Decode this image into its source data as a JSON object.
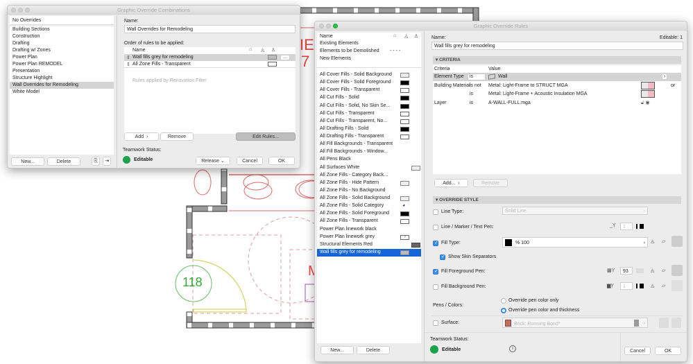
{
  "combinations": {
    "title": "Graphic Override Combinations",
    "no_overrides": "No Overrides",
    "items": [
      "Building Sections",
      "Construction",
      "Drafting",
      "Drafting w/ Zones",
      "Power Plan",
      "Power Plan REMODEL",
      "Presentation",
      "Structure Highlight",
      "Wall Overrides for Remodeling",
      "White Model"
    ],
    "selected": "Wall Overrides for Remodeling",
    "new_label": "New...",
    "delete_label": "Delete",
    "name_label": "Name:",
    "name_value": "Wall Overrides for Remodeling",
    "order_label": "Order of rules to be applied:",
    "col_name": "Name",
    "rules": [
      "Wall fills grey for remodeling",
      "All Zone Fills - Transparent"
    ],
    "more_label": "...",
    "renovation_note": "Rules applied by Renovation Filter",
    "add_label": "Add",
    "remove_label": "Remove",
    "edit_rules_label": "Edit Rules...",
    "teamwork_label": "Teamwork Status:",
    "status": "Editable",
    "release_label": "Release",
    "cancel_label": "Cancel",
    "ok_label": "OK"
  },
  "rules_dialog": {
    "title": "Graphic Override Rules",
    "col_name": "Name",
    "renovation": [
      {
        "label": "Existing Elements",
        "extra": ""
      },
      {
        "label": "Elements to be Demolished",
        "extra": "- - - -"
      },
      {
        "label": "New Elements",
        "extra": ""
      }
    ],
    "rules": [
      {
        "label": "All Cover Fills - Solid Background",
        "swatch": "light"
      },
      {
        "label": "All Cover Fills - Solid Foreground",
        "swatch": "black"
      },
      {
        "label": "All Cover Fills - Transparent",
        "swatch": "white"
      },
      {
        "label": "All Cut Fills - Solid",
        "swatch": "black"
      },
      {
        "label": "All Cut Fills - Solid, No Skin Se...",
        "swatch": "black"
      },
      {
        "label": "All Cut Fills - Transparent",
        "swatch": "white"
      },
      {
        "label": "All Cut Fills - Transparent, No...",
        "swatch": "white"
      },
      {
        "label": "All Drafting Fills - Solid",
        "swatch": "black"
      },
      {
        "label": "All Drafting Fills - Transparent",
        "swatch": "white"
      },
      {
        "label": "All Fill Backgrounds - Transparent",
        "swatch": "none"
      },
      {
        "label": "All Fill Backgrounds - Window...",
        "swatch": "none"
      },
      {
        "label": "All Pens Black",
        "swatch": "none"
      },
      {
        "label": "All Surfaces White",
        "swatch": "surface"
      },
      {
        "label": "All Zone Fills - Category Back...",
        "swatch": "none"
      },
      {
        "label": "All Zone Fills - Hide Pattern",
        "swatch": "light"
      },
      {
        "label": "All Zone Fills - No Background",
        "swatch": "none"
      },
      {
        "label": "All Zone Fills - Solid Background",
        "swatch": "light"
      },
      {
        "label": "All Zone Fills - Solid Category",
        "swatch": "palette"
      },
      {
        "label": "All Zone Fills - Solid Foreground",
        "swatch": "black"
      },
      {
        "label": "All Zone Fills - Transparent",
        "swatch": "white"
      },
      {
        "label": "Power Plan linework black",
        "swatch": "none"
      },
      {
        "label": "Power Plan linework grey",
        "swatch": "question"
      },
      {
        "label": "Structural Elements Red",
        "swatch": "dark"
      },
      {
        "label": "Wall fills grey for remodeling",
        "swatch": "grey"
      }
    ],
    "selected_index": 23,
    "question_mark": "?",
    "new_label": "New...",
    "delete_label": "Delete",
    "name_label": "Name:",
    "editable_count": "Editable: 1",
    "name_value": "Wall fills grey for remodeling",
    "criteria_header": "CRITERIA",
    "criteria_cols": [
      "Criteria",
      "Value"
    ],
    "criteria": [
      {
        "criterion": "Element Type",
        "op": "is",
        "value": "Wall",
        "suffix": ""
      },
      {
        "criterion": "Building Material",
        "op": "is not",
        "value": "Metal: Light-Frame to STRUCT MGA",
        "suffix": "or"
      },
      {
        "criterion": "",
        "op": "is",
        "value": "Metal: Light-Frame + Acoustic Insulation MGA",
        "suffix": ""
      },
      {
        "criterion": "Layer",
        "op": "is",
        "value": "A-WALL-FULL.mga",
        "suffix": ""
      }
    ],
    "add_label": "Add...",
    "remove_label": "Remove",
    "override_header": "OVERRIDE STYLE",
    "line_type_label": "Line Type:",
    "line_type_value": "Solid Line",
    "line_type_checked": false,
    "line_pen_label": "Line / Marker / Text Pen:",
    "line_pen_value": "1",
    "line_pen_checked": false,
    "fill_type_label": "Fill Type:",
    "fill_type_value": "% 100",
    "fill_type_checked": true,
    "skin_label": "Show Skin Separators",
    "skin_checked": true,
    "fill_fg_label": "Fill Foreground Pen:",
    "fill_fg_value": "93",
    "fill_fg_checked": true,
    "fill_bg_label": "Fill Background Pen:",
    "fill_bg_value": "1",
    "fill_bg_checked": false,
    "pens_label": "Pens / Colors:",
    "pen_options": [
      "Override pen color only",
      "Override pen color and thickness"
    ],
    "pen_selected": 1,
    "surface_label": "Surface:",
    "surface_value": "Brick: Running Bond*",
    "surface_checked": false,
    "teamwork_label": "Teamwork Status:",
    "status": "Editable",
    "cancel_label": "Cancel",
    "ok_label": "OK",
    "colors": {
      "accent": "#1565d8",
      "status": "#1aa34a",
      "surface": "#c0705a",
      "wall_pink": "#f1b9c4"
    }
  },
  "plan": {
    "room_number": "118",
    "tag_fragment_1": "IE",
    "tag_fragment_2": "7",
    "tag_fragment_3": "M"
  }
}
